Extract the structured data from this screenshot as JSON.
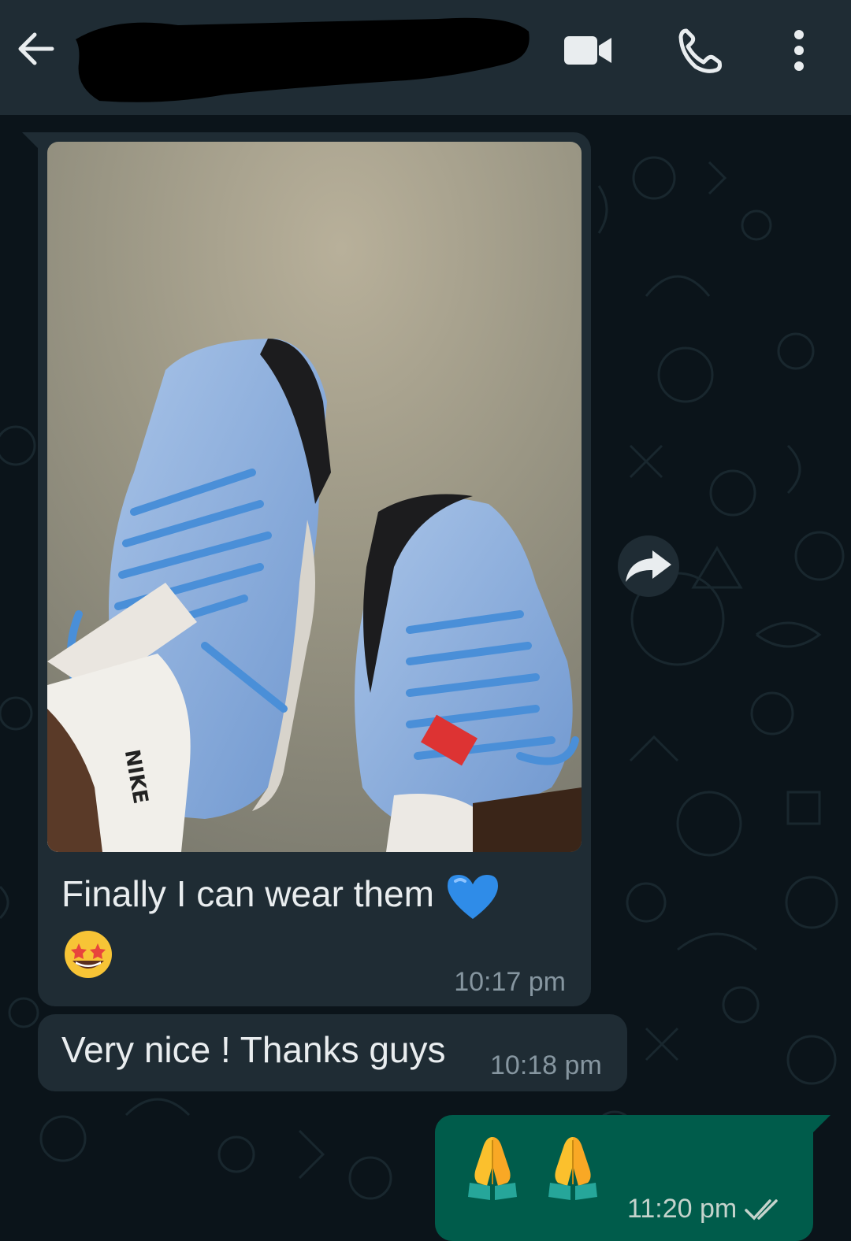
{
  "header": {
    "contact_name": "",
    "back_icon": "arrow-left-icon",
    "video_icon": "video-camera-icon",
    "call_icon": "phone-icon",
    "menu_icon": "more-vert-icon"
  },
  "messages": [
    {
      "direction": "incoming",
      "type": "image",
      "caption": "Finally I can wear them",
      "caption_emojis": [
        "blue-heart",
        "star-struck"
      ],
      "time": "10:17 pm"
    },
    {
      "direction": "incoming",
      "type": "text",
      "text": "Very nice ! Thanks guys",
      "time": "10:18 pm"
    },
    {
      "direction": "outgoing",
      "type": "emoji",
      "emojis": [
        "folded-hands",
        "folded-hands"
      ],
      "time": "11:20 pm",
      "status": "read"
    }
  ],
  "colors": {
    "header_bg": "#1f2c34",
    "chat_bg": "#0b141a",
    "incoming_bubble": "#1f2c34",
    "outgoing_bubble": "#005c4b",
    "text_primary": "#e9edef",
    "text_secondary": "#8696a0",
    "read_ticks": "#c5d3cc"
  }
}
